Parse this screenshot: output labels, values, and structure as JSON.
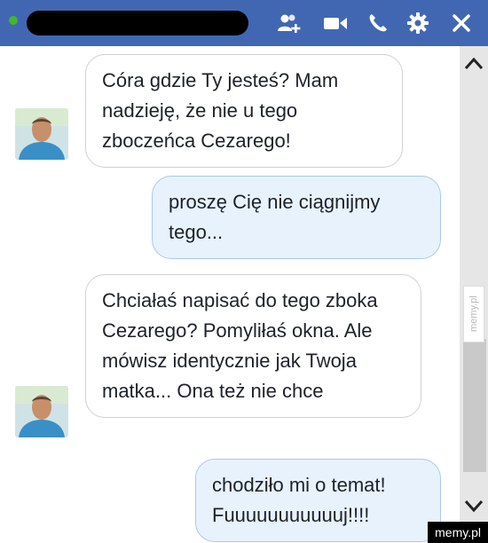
{
  "header": {
    "contact_name": "",
    "icons": [
      "add-people-icon",
      "video-call-icon",
      "phone-icon",
      "gear-icon",
      "close-icon"
    ]
  },
  "messages": [
    {
      "direction": "in",
      "text": "Córa gdzie Ty jesteś? Mam nadzieję, że nie u tego zboczeńca Cezarego!"
    },
    {
      "direction": "out",
      "text": "proszę Cię nie ciągnijmy tego..."
    },
    {
      "direction": "in",
      "text": "Chciałaś napisać do tego zboka Cezarego? Pomyliłaś okna. Ale mówisz identycznie jak Twoja matka... Ona też nie chce"
    },
    {
      "direction": "out",
      "text": "chodziło mi o temat! Fuuuuuuuuuuuj!!!!"
    }
  ],
  "watermark": {
    "side": "memy.pl",
    "corner": "memy.pl"
  },
  "colors": {
    "header": "#4267b2",
    "online": "#42b72a",
    "outgoing_bubble": "#e8f2fd"
  }
}
